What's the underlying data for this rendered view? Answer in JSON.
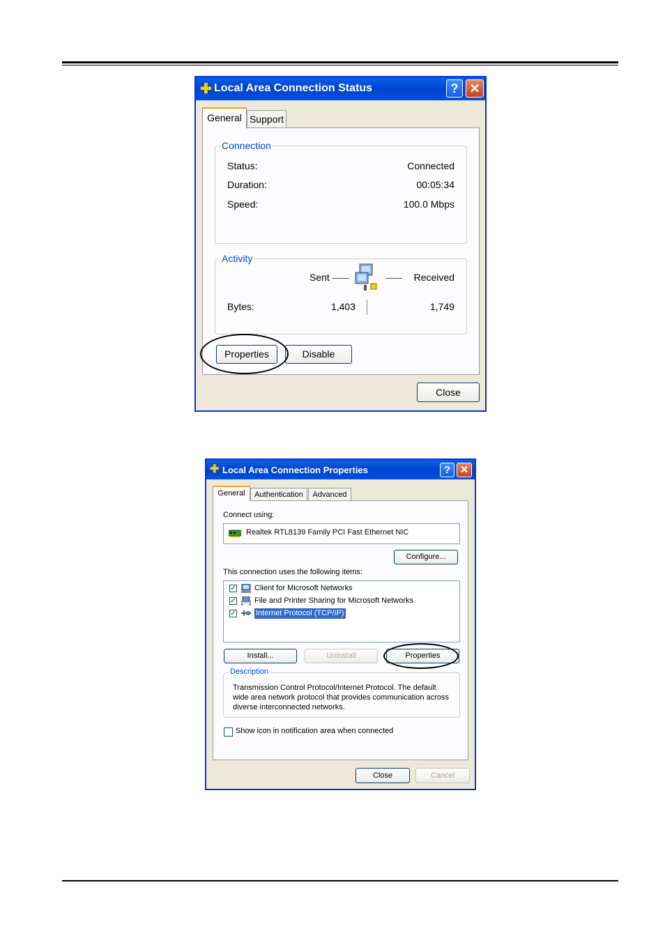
{
  "status_dialog": {
    "title": "Local Area Connection Status",
    "tabs": [
      "General",
      "Support"
    ],
    "connection": {
      "legend": "Connection",
      "status_label": "Status:",
      "status_value": "Connected",
      "duration_label": "Duration:",
      "duration_value": "00:05:34",
      "speed_label": "Speed:",
      "speed_value": "100.0 Mbps"
    },
    "activity": {
      "legend": "Activity",
      "sent_label": "Sent",
      "received_label": "Received",
      "bytes_label": "Bytes:",
      "bytes_sent": "1,403",
      "bytes_received": "1,749"
    },
    "properties_button": "Properties",
    "disable_button": "Disable",
    "close_button": "Close"
  },
  "properties_dialog": {
    "title": "Local Area Connection Properties",
    "tabs": [
      "General",
      "Authentication",
      "Advanced"
    ],
    "connect_using_label": "Connect using:",
    "adapter_name": "Realtek RTL8139 Family PCI Fast Ethernet NIC",
    "configure_button": "Configure...",
    "items_label": "This connection uses the following items:",
    "items": [
      {
        "label": "Client for Microsoft Networks",
        "checked": true,
        "icon": "network-client-icon"
      },
      {
        "label": "File and Printer Sharing for Microsoft Networks",
        "checked": true,
        "icon": "file-printer-sharing-icon"
      },
      {
        "label": "Internet Protocol (TCP/IP)",
        "checked": true,
        "icon": "protocol-icon",
        "selected": true
      }
    ],
    "install_button": "Install...",
    "uninstall_button": "Uninstall",
    "properties_button": "Properties",
    "description_legend": "Description",
    "description_text": "Transmission Control Protocol/Internet Protocol. The default wide area network protocol that provides communication across diverse interconnected networks.",
    "show_icon_label": "Show icon in notification area when connected",
    "show_icon_checked": false,
    "close_button": "Close",
    "cancel_button": "Cancel"
  },
  "colors": {
    "title_blue": "#0a5ee8",
    "dialog_bg": "#ece9d8",
    "legend_blue": "#0046d5",
    "selection_blue": "#316ac5",
    "close_red": "#c8401c"
  }
}
